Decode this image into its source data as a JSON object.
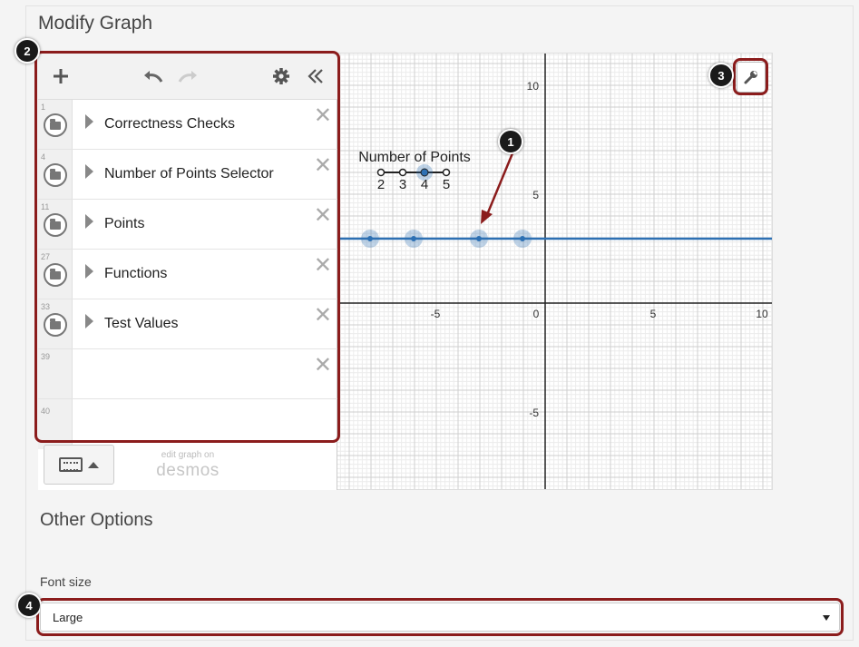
{
  "page": {
    "title": "Modify Graph"
  },
  "expression_list": {
    "rows": [
      {
        "number": "1",
        "label": "Correctness Checks"
      },
      {
        "number": "4",
        "label": "Number of Points Selector"
      },
      {
        "number": "11",
        "label": "Points"
      },
      {
        "number": "27",
        "label": "Functions"
      },
      {
        "number": "33",
        "label": "Test Values"
      },
      {
        "number": "39",
        "label": ""
      },
      {
        "number": "40",
        "label": ""
      }
    ],
    "edit_link": "edit graph on",
    "logo": "desmos"
  },
  "graph": {
    "x_ticks": [
      "-5",
      "0",
      "5",
      "10"
    ],
    "y_ticks": [
      "10",
      "5",
      "-5"
    ],
    "slider_title": "Number of Points",
    "slider_labels": [
      "2",
      "3",
      "4",
      "5"
    ],
    "slider_value": 4,
    "colors": {
      "line": "#2d70b3",
      "point": "#2d70b3"
    }
  },
  "callouts": [
    "1",
    "2",
    "3",
    "4"
  ],
  "other_options": {
    "title": "Other Options",
    "font_size_label": "Font size",
    "font_size_value": "Large"
  },
  "colors": {
    "highlight": "#8b1c1c",
    "badge": "#1a1a1a"
  }
}
